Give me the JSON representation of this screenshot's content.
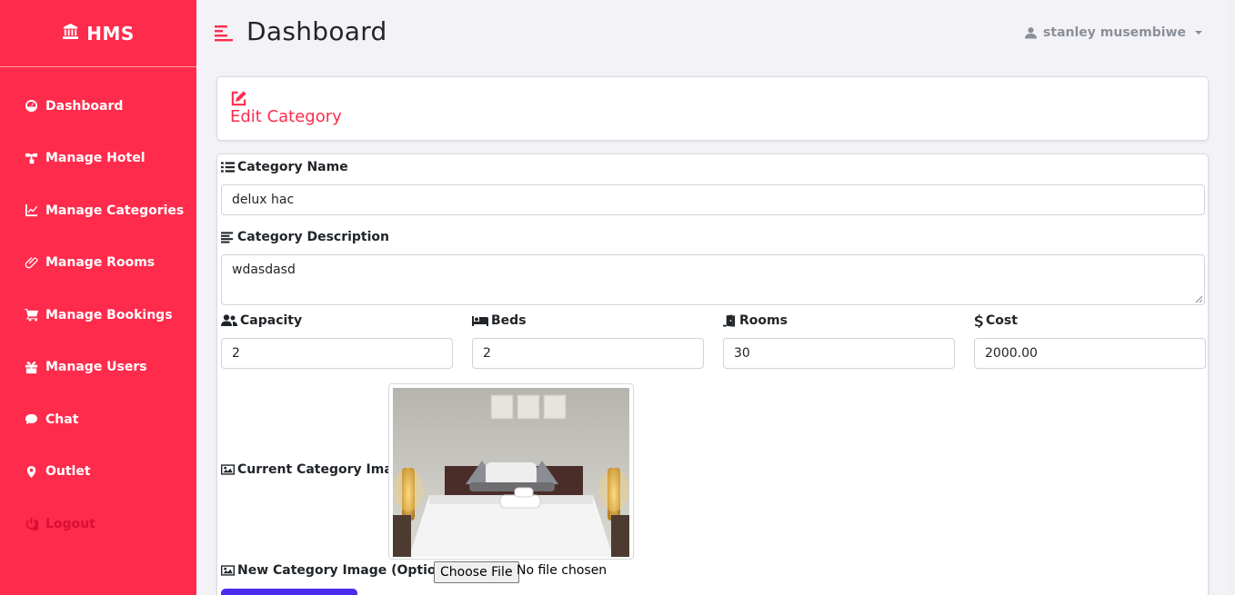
{
  "brand": {
    "name": "HMS",
    "icon": "hotel-icon"
  },
  "sidebar": {
    "items": [
      {
        "label": "Dashboard",
        "icon": "tachometer-icon"
      },
      {
        "label": "Manage Hotel",
        "icon": "sitemap-icon"
      },
      {
        "label": "Manage Categories",
        "icon": "chart-line-icon"
      },
      {
        "label": "Manage Rooms",
        "icon": "paperclip-icon"
      },
      {
        "label": "Manage Bookings",
        "icon": "cart-icon"
      },
      {
        "label": "Manage Users",
        "icon": "gift-icon"
      },
      {
        "label": "Chat",
        "icon": "comment-icon"
      },
      {
        "label": "Outlet",
        "icon": "map-marker-icon"
      },
      {
        "label": "Logout",
        "icon": "power-icon"
      }
    ]
  },
  "topbar": {
    "title": "Dashboard",
    "user": "stanley musembiwe"
  },
  "card": {
    "title": "Edit Category"
  },
  "form": {
    "name_label": "Category Name",
    "name_value": "delux hac",
    "desc_label": "Category Description",
    "desc_value": "wdasdasd",
    "capacity_label": "Capacity",
    "capacity_value": "2",
    "beds_label": "Beds",
    "beds_value": "2",
    "rooms_label": "Rooms",
    "rooms_value": "30",
    "cost_label": "Cost",
    "cost_value": "2000.00",
    "current_image_label": "Current Category Image",
    "new_image_label": "New Category Image (Optional)",
    "file_button": "Choose File",
    "file_status": "No file chosen"
  },
  "colors": {
    "accent": "#ff2b4c",
    "submit": "#4a2cf0",
    "logout": "#d80f37"
  }
}
